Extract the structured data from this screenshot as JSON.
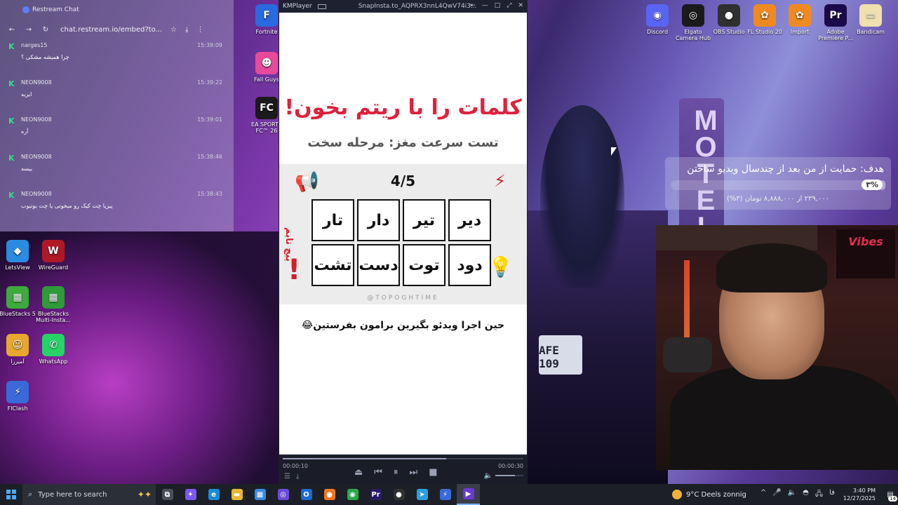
{
  "restream": {
    "title": "Restream Chat",
    "url": "chat.restream.io/embed?to...",
    "messages": [
      {
        "name": "narges15",
        "time": "15:39:09",
        "text": "چرا همیشه مشکی ؟"
      },
      {
        "name": "NEON9008",
        "time": "15:39:22",
        "text": "ایزیه"
      },
      {
        "name": "NEON9008",
        "time": "15:39:01",
        "text": "آره"
      },
      {
        "name": "NEON9008",
        "time": "15:38:46",
        "text": "بیسه"
      },
      {
        "name": "NEON9008",
        "time": "15:38:43",
        "text": "پیزیا چت کیک رو میخونی یا چت یوتیوب"
      }
    ]
  },
  "desktop_left": [
    {
      "label": "LetsView",
      "icon": "letsview-icon",
      "color": "#2a8ce0",
      "glyph": "◆"
    },
    {
      "label": "WireGuard",
      "icon": "wireguard-icon",
      "color": "#b01828",
      "glyph": "W"
    },
    {
      "label": "BlueStacks 5",
      "icon": "bluestacks-icon",
      "color": "#3caa3c",
      "glyph": "▦"
    },
    {
      "label": "BlueStacks Multi-Insta...",
      "icon": "bluestacks-multi-icon",
      "color": "#2e9a3a",
      "glyph": "▦"
    },
    {
      "label": "آمیرزا",
      "icon": "amirza-icon",
      "color": "#e8a830",
      "glyph": "☺"
    },
    {
      "label": "WhatsApp",
      "icon": "whatsapp-icon",
      "color": "#25d366",
      "glyph": "✆"
    },
    {
      "label": "FlClash",
      "icon": "flclash-icon",
      "color": "#3a6ad8",
      "glyph": "⚡"
    }
  ],
  "desktop_mid": [
    {
      "label": "Fortnite",
      "icon": "fortnite-icon",
      "color": "#2a6ae0",
      "glyph": "F"
    },
    {
      "label": "Fall Guys",
      "icon": "fallguys-icon",
      "color": "#e84a9a",
      "glyph": "☻"
    },
    {
      "label": "EA SPORTS FC™ 26",
      "icon": "eafc-icon",
      "color": "#1a1a1a",
      "glyph": "FC"
    }
  ],
  "desktop_right": [
    {
      "label": "Discord",
      "icon": "discord-icon",
      "color": "#5865f2",
      "glyph": "◉"
    },
    {
      "label": "Elgato Camera Hub",
      "icon": "elgato-icon",
      "color": "#1a1a1a",
      "glyph": "◎"
    },
    {
      "label": "OBS Studio",
      "icon": "obs-icon",
      "color": "#303030",
      "glyph": "●"
    },
    {
      "label": "FL Studio 20",
      "icon": "flstudio-icon",
      "color": "#f08a20",
      "glyph": "✿"
    },
    {
      "label": "Import",
      "icon": "import-icon",
      "color": "#f08a20",
      "glyph": "✿"
    },
    {
      "label": "Adobe Premiere P...",
      "icon": "premiere-icon",
      "color": "#1a0a4a",
      "glyph": "Pr"
    },
    {
      "label": "Bandicam",
      "icon": "bandicam-icon",
      "color": "#f0e0b0",
      "glyph": "▭"
    }
  ],
  "kmplayer": {
    "brand": "KMPlayer",
    "file": "SnapInsta.to_AQPRX3nnL4QwV74i3...",
    "video": {
      "title": "کلمات را با ریتم بخون!",
      "subtitle": "تست سرعت مغز: مرحله سخت",
      "counter": "4/5",
      "words": [
        "دیر",
        "تیر",
        "دار",
        "تار",
        "دود",
        "توت",
        "دست",
        "تشت"
      ],
      "side_text": "پیچ تایم",
      "handle": "@TOPOGHTIME",
      "note": "حین اجرا ویدئو بگیرین برامون بفرستین😂"
    },
    "time_current": "00:00:10",
    "time_total": "00:00:30",
    "progress": 0.68,
    "volume": 0.7
  },
  "donation": {
    "goal": "هدف: حمایت از من بعد از چندسال ویدیو ساختن",
    "percent_label": "۳%",
    "percent": 0.03,
    "amount": "۲۳۹,۰۰۰ از ۸,۸۸۸,۰۰۰ تومان (۳%)"
  },
  "webcam": {
    "poster": "Vibes"
  },
  "wallpaper": {
    "plate": "AFE 109",
    "sign": "MOTEL"
  },
  "taskbar": {
    "search_placeholder": "Type here to search",
    "apps": [
      {
        "name": "task-view-icon",
        "glyph": "⧉",
        "color": "#4a4e58"
      },
      {
        "name": "copilot-icon",
        "glyph": "✦",
        "color": "#7a5af0"
      },
      {
        "name": "edge-icon",
        "glyph": "e",
        "color": "#1a8ad8"
      },
      {
        "name": "file-explorer-icon",
        "glyph": "▬",
        "color": "#e8b830"
      },
      {
        "name": "store-icon",
        "glyph": "▦",
        "color": "#3a8ae0"
      },
      {
        "name": "elgato-app-icon",
        "glyph": "◎",
        "color": "#6a4ad8"
      },
      {
        "name": "outlook-icon",
        "glyph": "O",
        "color": "#1a6ad0"
      },
      {
        "name": "firefox-icon",
        "glyph": "●",
        "color": "#f07820"
      },
      {
        "name": "chrome-icon",
        "glyph": "◉",
        "color": "#2aa84a"
      },
      {
        "name": "premiere-task-icon",
        "glyph": "Pr",
        "color": "#2a1a6a"
      },
      {
        "name": "obs-task-icon",
        "glyph": "●",
        "color": "#303030"
      },
      {
        "name": "telegram-icon",
        "glyph": "➤",
        "color": "#2aa0e0"
      },
      {
        "name": "flclash-task-icon",
        "glyph": "⚡",
        "color": "#3a6ad8"
      },
      {
        "name": "kmplayer-task-icon",
        "glyph": "▶",
        "color": "#6a3ad0"
      }
    ],
    "weather": "9°C  Deels zonnig",
    "tray": [
      "^",
      "🎤",
      "🔈",
      "◓",
      "🖧",
      "فا"
    ],
    "time": "3:40 PM",
    "date": "12/27/2025",
    "notifications": "14"
  }
}
